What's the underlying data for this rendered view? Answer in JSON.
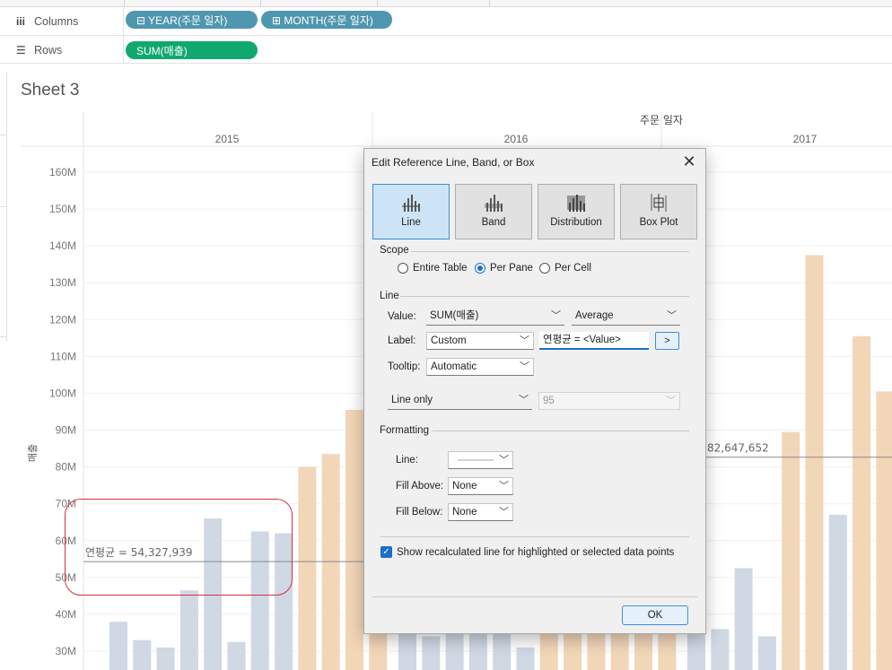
{
  "shelves": {
    "columns_label": "Columns",
    "rows_label": "Rows",
    "columns_pills": [
      "⊟ YEAR(주문 일자)",
      "⊞ MONTH(주문 일자)"
    ],
    "rows_pills": [
      "SUM(매출)"
    ]
  },
  "sheet": {
    "title": "Sheet 3"
  },
  "chart_data": {
    "type": "bar",
    "header_title": "주문 일자",
    "panes": [
      "2015",
      "2016",
      "2017"
    ],
    "ylabel": "매출",
    "yticks": [
      "30M",
      "40M",
      "50M",
      "60M",
      "70M",
      "80M",
      "90M",
      "100M",
      "110M",
      "120M",
      "130M",
      "140M",
      "150M",
      "160M"
    ],
    "ylim": [
      30,
      160
    ],
    "unit": "M",
    "series": [
      {
        "pane": "2015",
        "values": [
          38,
          33,
          31,
          46.5,
          66,
          32.5,
          62.5,
          62,
          80,
          83.5,
          95.5,
          96
        ],
        "colors": [
          "#cfd8e3",
          "#cfd8e3",
          "#cfd8e3",
          "#cfd8e3",
          "#cfd8e3",
          "#cfd8e3",
          "#cfd8e3",
          "#cfd8e3",
          "#f2d6b8",
          "#f2d6b8",
          "#f2d6b8",
          "#f2d6b8"
        ]
      },
      {
        "pane": "2016",
        "values": [
          36,
          34,
          41,
          39,
          45,
          31,
          42,
          46,
          48,
          44,
          41,
          47
        ],
        "colors": [
          "#cfd8e3",
          "#cfd8e3",
          "#cfd8e3",
          "#cfd8e3",
          "#cfd8e3",
          "#cfd8e3",
          "#f2d6b8",
          "#f2d6b8",
          "#f2d6b8",
          "#f2d6b8",
          "#f2d6b8",
          "#f2d6b8"
        ]
      },
      {
        "pane": "2017",
        "values": [
          35,
          36,
          52.5,
          34,
          89.5,
          137.5,
          67,
          115.5,
          100.5,
          99
        ],
        "colors": [
          "#cfd8e3",
          "#cfd8e3",
          "#cfd8e3",
          "#cfd8e3",
          "#f2d6b8",
          "#f2d6b8",
          "#cfd8e3",
          "#f2d6b8",
          "#f2d6b8",
          "#f2d6b8"
        ]
      }
    ],
    "reference_lines": [
      {
        "pane": "2015",
        "value": 54.327939,
        "label": "연평균 = 54,327,939"
      },
      {
        "pane": "2017",
        "value": 82.647652,
        "label": "82,647,652"
      }
    ]
  },
  "dialog": {
    "title": "Edit Reference Line, Band, or Box",
    "close_glyph": "✕",
    "type_buttons": [
      {
        "label": "Line",
        "icon": "line-chart-icon",
        "selected": true
      },
      {
        "label": "Band",
        "icon": "band-chart-icon",
        "selected": false
      },
      {
        "label": "Distribution",
        "icon": "distribution-chart-icon",
        "selected": false
      },
      {
        "label": "Box Plot",
        "icon": "box-plot-icon",
        "selected": false
      }
    ],
    "scope": {
      "heading": "Scope",
      "options": [
        {
          "label": "Entire Table",
          "checked": false
        },
        {
          "label": "Per Pane",
          "checked": true
        },
        {
          "label": "Per Cell",
          "checked": false
        }
      ]
    },
    "line": {
      "heading": "Line",
      "value_label": "Value:",
      "value_field": "SUM(매출)",
      "value_agg": "Average",
      "label_label": "Label:",
      "label_mode": "Custom",
      "label_text": "연평균 = <Value>",
      "insert_button": ">",
      "tooltip_label": "Tooltip:",
      "tooltip_mode": "Automatic",
      "ci_mode": "Line only",
      "ci_value": "95"
    },
    "formatting": {
      "heading": "Formatting",
      "line_label": "Line:",
      "fill_above_label": "Fill Above:",
      "fill_above": "None",
      "fill_below_label": "Fill Below:",
      "fill_below": "None"
    },
    "recalc_checkbox": "Show recalculated line for highlighted or selected data points",
    "ok_label": "OK"
  }
}
